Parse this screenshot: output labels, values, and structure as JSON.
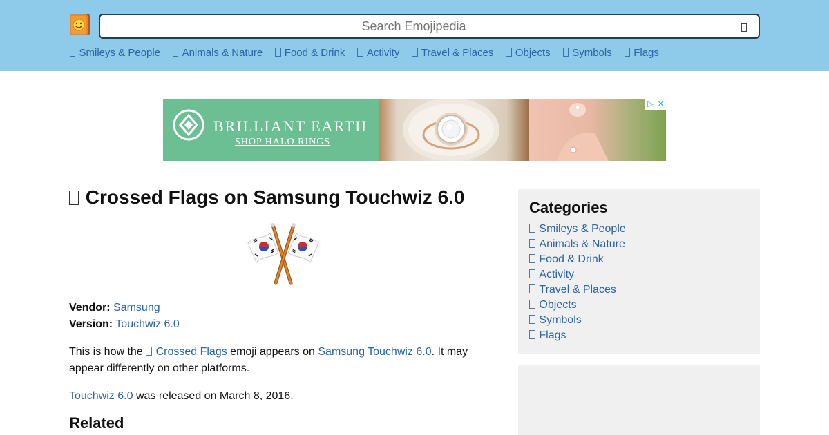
{
  "header": {
    "logo_icon": "emojipedia-book-logo",
    "search": {
      "placeholder": "Search Emojipedia",
      "value": "",
      "button_icon": "search-icon"
    },
    "nav": [
      {
        "label": "Smileys & People"
      },
      {
        "label": "Animals & Nature"
      },
      {
        "label": "Food & Drink"
      },
      {
        "label": "Activity"
      },
      {
        "label": "Travel & Places"
      },
      {
        "label": "Objects"
      },
      {
        "label": "Symbols"
      },
      {
        "label": "Flags"
      }
    ],
    "colors": {
      "background": "#8ecae9",
      "link": "#2b64a8"
    }
  },
  "ad": {
    "brand": "BRILLIANT EARTH",
    "cta": "SHOP HALO RINGS",
    "adchoices_icon": "adchoices-icon",
    "close_icon": "close-icon",
    "adchoices_glyph": "▷",
    "close_glyph": "✕",
    "colors": {
      "brand_bg": "#6cbf93"
    }
  },
  "main": {
    "title": "Crossed Flags on Samsung Touchwiz 6.0",
    "emoji_image": "crossed-flags-emoji",
    "vendor_label": "Vendor:",
    "vendor_value": "Samsung",
    "version_label": "Version:",
    "version_value": "Touchwiz 6.0",
    "desc_1": "This is how the",
    "desc_link_emoji": "Crossed Flags",
    "desc_2": "emoji appears on",
    "desc_link_platform": "Samsung Touchwiz 6.0",
    "desc_3": ". It may appear differently on other platforms.",
    "release_link": "Touchwiz 6.0",
    "release_text": "was released on March 8, 2016.",
    "related_heading": "Related"
  },
  "sidebar": {
    "title": "Categories",
    "items": [
      {
        "label": "Smileys & People"
      },
      {
        "label": "Animals & Nature"
      },
      {
        "label": "Food & Drink"
      },
      {
        "label": "Activity"
      },
      {
        "label": "Travel & Places"
      },
      {
        "label": "Objects"
      },
      {
        "label": "Symbols"
      },
      {
        "label": "Flags"
      }
    ]
  }
}
